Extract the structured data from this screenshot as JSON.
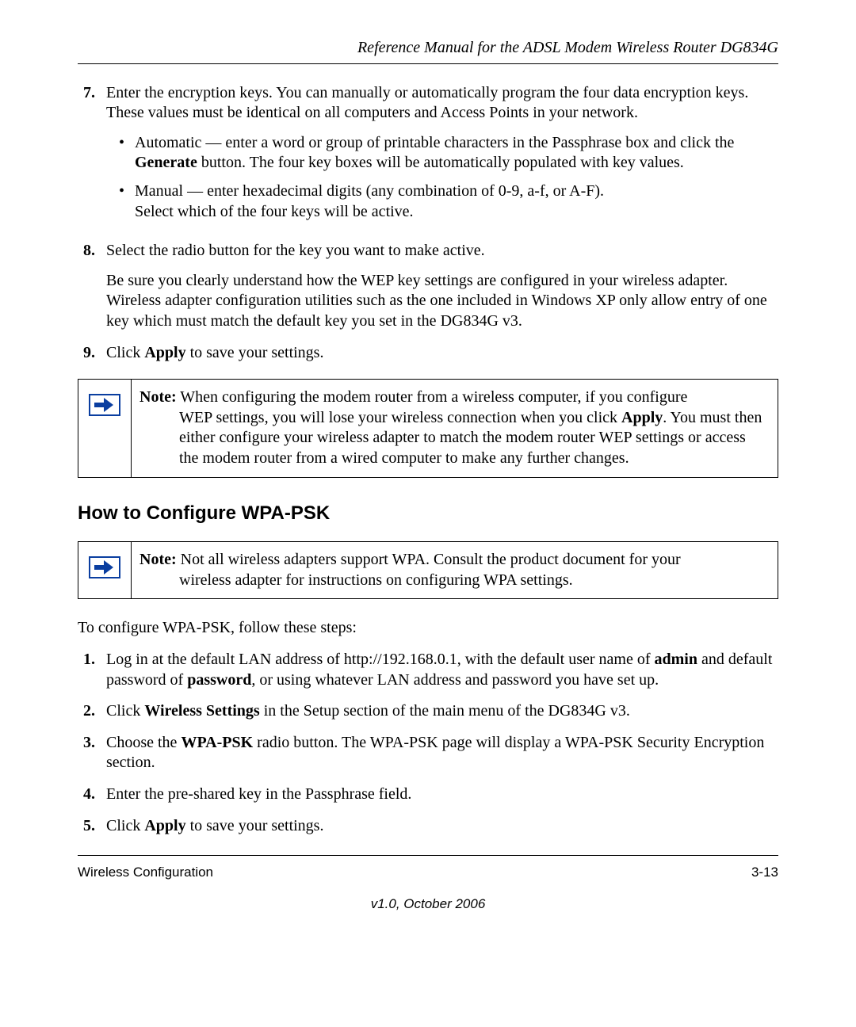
{
  "header": {
    "running": "Reference Manual for the ADSL Modem Wireless Router DG834G"
  },
  "steps_a": [
    {
      "num": "7.",
      "lead": "Enter the encryption keys. You can manually or automatically program the four data encryption keys. These values must be identical on all computers and Access Points in your network.",
      "bullets": [
        {
          "pre": "Automatic — enter a word or group of printable characters in the Passphrase box and click the ",
          "bold1": "Generate",
          "post": " button. The four key boxes will be automatically populated with key values."
        },
        {
          "pre": "Manual — enter hexadecimal digits (any combination of 0-9, a-f, or A-F).",
          "line2": "Select which of the four keys will be active."
        }
      ]
    },
    {
      "num": "8.",
      "lead": "Select the radio button for the key you want to make active.",
      "para2": "Be sure you clearly understand how the WEP key settings are configured in your wireless adapter. Wireless adapter configuration utilities such as the one included in Windows XP only allow entry of one key which must match the default key you set in the DG834G v3."
    },
    {
      "num": "9.",
      "lead_pre": "Click ",
      "lead_bold": "Apply",
      "lead_post": " to save your settings."
    }
  ],
  "note1": {
    "label": "Note:",
    "line1": " When configuring the modem router from a wireless computer, if you configure",
    "rest_pre": "WEP settings, you will lose your wireless connection when you click ",
    "rest_bold": "Apply",
    "rest_post": ". You must then either configure your wireless adapter to match the modem router WEP settings or access the modem router from a wired computer to make any further changes."
  },
  "section_heading": "How to Configure WPA-PSK",
  "note2": {
    "label": "Note:",
    "line1": " Not all wireless adapters support WPA. Consult the product document for your",
    "rest": "wireless adapter for instructions on configuring WPA settings."
  },
  "wpa_intro": "To configure WPA-PSK, follow these steps:",
  "steps_b": [
    {
      "num": "1.",
      "pre": "Log in at the default LAN address of http://192.168.0.1, with the default user name of ",
      "b1": "admin",
      "mid": " and default password of ",
      "b2": "password",
      "post": ", or using whatever LAN address and password you have set up."
    },
    {
      "num": "2.",
      "pre": "Click ",
      "b1": "Wireless Settings",
      "post": " in the Setup section of the main menu of the DG834G v3."
    },
    {
      "num": "3.",
      "pre": "Choose the ",
      "b1": "WPA-PSK",
      "post": " radio button. The WPA-PSK page will display a WPA-PSK Security Encryption section."
    },
    {
      "num": "4.",
      "plain": "Enter the pre-shared key in the Passphrase field."
    },
    {
      "num": "5.",
      "pre": "Click ",
      "b1": "Apply",
      "post": " to save your settings."
    }
  ],
  "footer": {
    "left": "Wireless Configuration",
    "right": "3-13",
    "version": "v1.0, October 2006"
  }
}
